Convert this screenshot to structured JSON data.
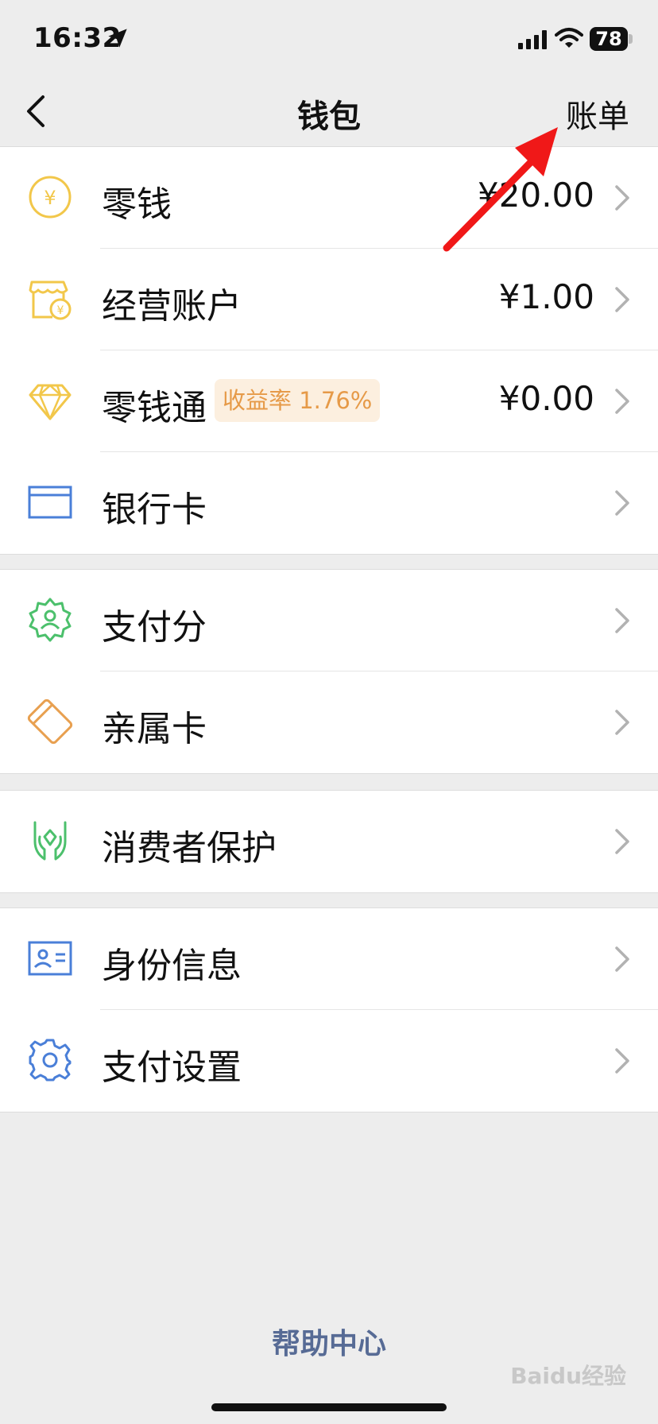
{
  "status_bar": {
    "time": "16:32",
    "battery": "78"
  },
  "nav": {
    "title": "钱包",
    "bill": "账单"
  },
  "groups": [
    {
      "items": [
        {
          "label": "零钱",
          "value": "¥20.00",
          "icon": "yuan-coin-icon"
        },
        {
          "label": "经营账户",
          "value": "¥1.00",
          "icon": "store-icon"
        },
        {
          "label": "零钱通",
          "badge": "收益率 1.76%",
          "value": "¥0.00",
          "icon": "diamond-icon"
        },
        {
          "label": "银行卡",
          "value": "",
          "icon": "bank-card-icon"
        }
      ]
    },
    {
      "items": [
        {
          "label": "支付分",
          "icon": "pay-score-icon"
        },
        {
          "label": "亲属卡",
          "icon": "family-card-icon"
        }
      ]
    },
    {
      "items": [
        {
          "label": "消费者保护",
          "icon": "consumer-protection-icon"
        }
      ]
    },
    {
      "items": [
        {
          "label": "身份信息",
          "icon": "id-card-icon"
        },
        {
          "label": "支付设置",
          "icon": "gear-icon"
        }
      ]
    }
  ],
  "help": "帮助中心",
  "watermark": "Baidu经验",
  "colors": {
    "icon_yellow": "#f2c74a",
    "icon_green": "#4cc06c",
    "icon_orange": "#e8a050",
    "icon_blue": "#4a7fd8",
    "link": "#576b95",
    "arrow": "#f01818"
  }
}
